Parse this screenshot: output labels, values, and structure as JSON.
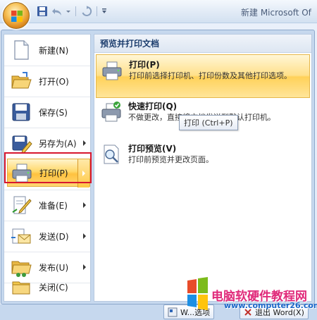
{
  "window": {
    "title": "新建 Microsoft Of"
  },
  "quick_access": {
    "icons": [
      "save-icon",
      "undo-icon",
      "undo-dropdown-icon",
      "redo-icon",
      "customize-icon"
    ]
  },
  "menu": {
    "items": [
      {
        "label": "新建(N)",
        "icon": "new-document-icon",
        "submenu": false
      },
      {
        "label": "打开(O)",
        "icon": "open-folder-icon",
        "submenu": false
      },
      {
        "label": "保存(S)",
        "icon": "save-disk-icon",
        "submenu": false
      },
      {
        "label": "另存为(A)",
        "icon": "save-as-icon",
        "submenu": true
      },
      {
        "label": "打印(P)",
        "icon": "printer-icon",
        "submenu": true,
        "active": true
      },
      {
        "label": "准备(E)",
        "icon": "prepare-icon",
        "submenu": true
      },
      {
        "label": "发送(D)",
        "icon": "send-icon",
        "submenu": true
      },
      {
        "label": "发布(U)",
        "icon": "publish-icon",
        "submenu": true
      },
      {
        "label": "关闭(C)",
        "icon": "close-folder-icon",
        "submenu": false
      }
    ]
  },
  "submenu": {
    "header": "预览并打印文档",
    "items": [
      {
        "title": "打印(P)",
        "desc": "打印前选择打印机、打印份数及其他打印选项。",
        "icon": "printer-icon",
        "active": true
      },
      {
        "title": "快速打印(Q)",
        "desc": "不做更改，直接将文档发送到默认打印机。",
        "icon": "quick-print-icon"
      },
      {
        "title": "打印预览(V)",
        "desc": "打印前预览并更改页面。",
        "icon": "print-preview-icon"
      }
    ],
    "tooltip": "打印 (Ctrl+P)"
  },
  "bottom": {
    "options_label": "W...选项",
    "exit_label": "退出 Word(X)"
  },
  "watermark": {
    "site_name": "电脑软硬件教程网",
    "url": "www.computer26.com"
  },
  "colors": {
    "active_highlight": "#ffd86a",
    "selection_box": "#d7172f",
    "watermark_pink": "#e02a7a",
    "watermark_blue": "#1b67c9"
  }
}
